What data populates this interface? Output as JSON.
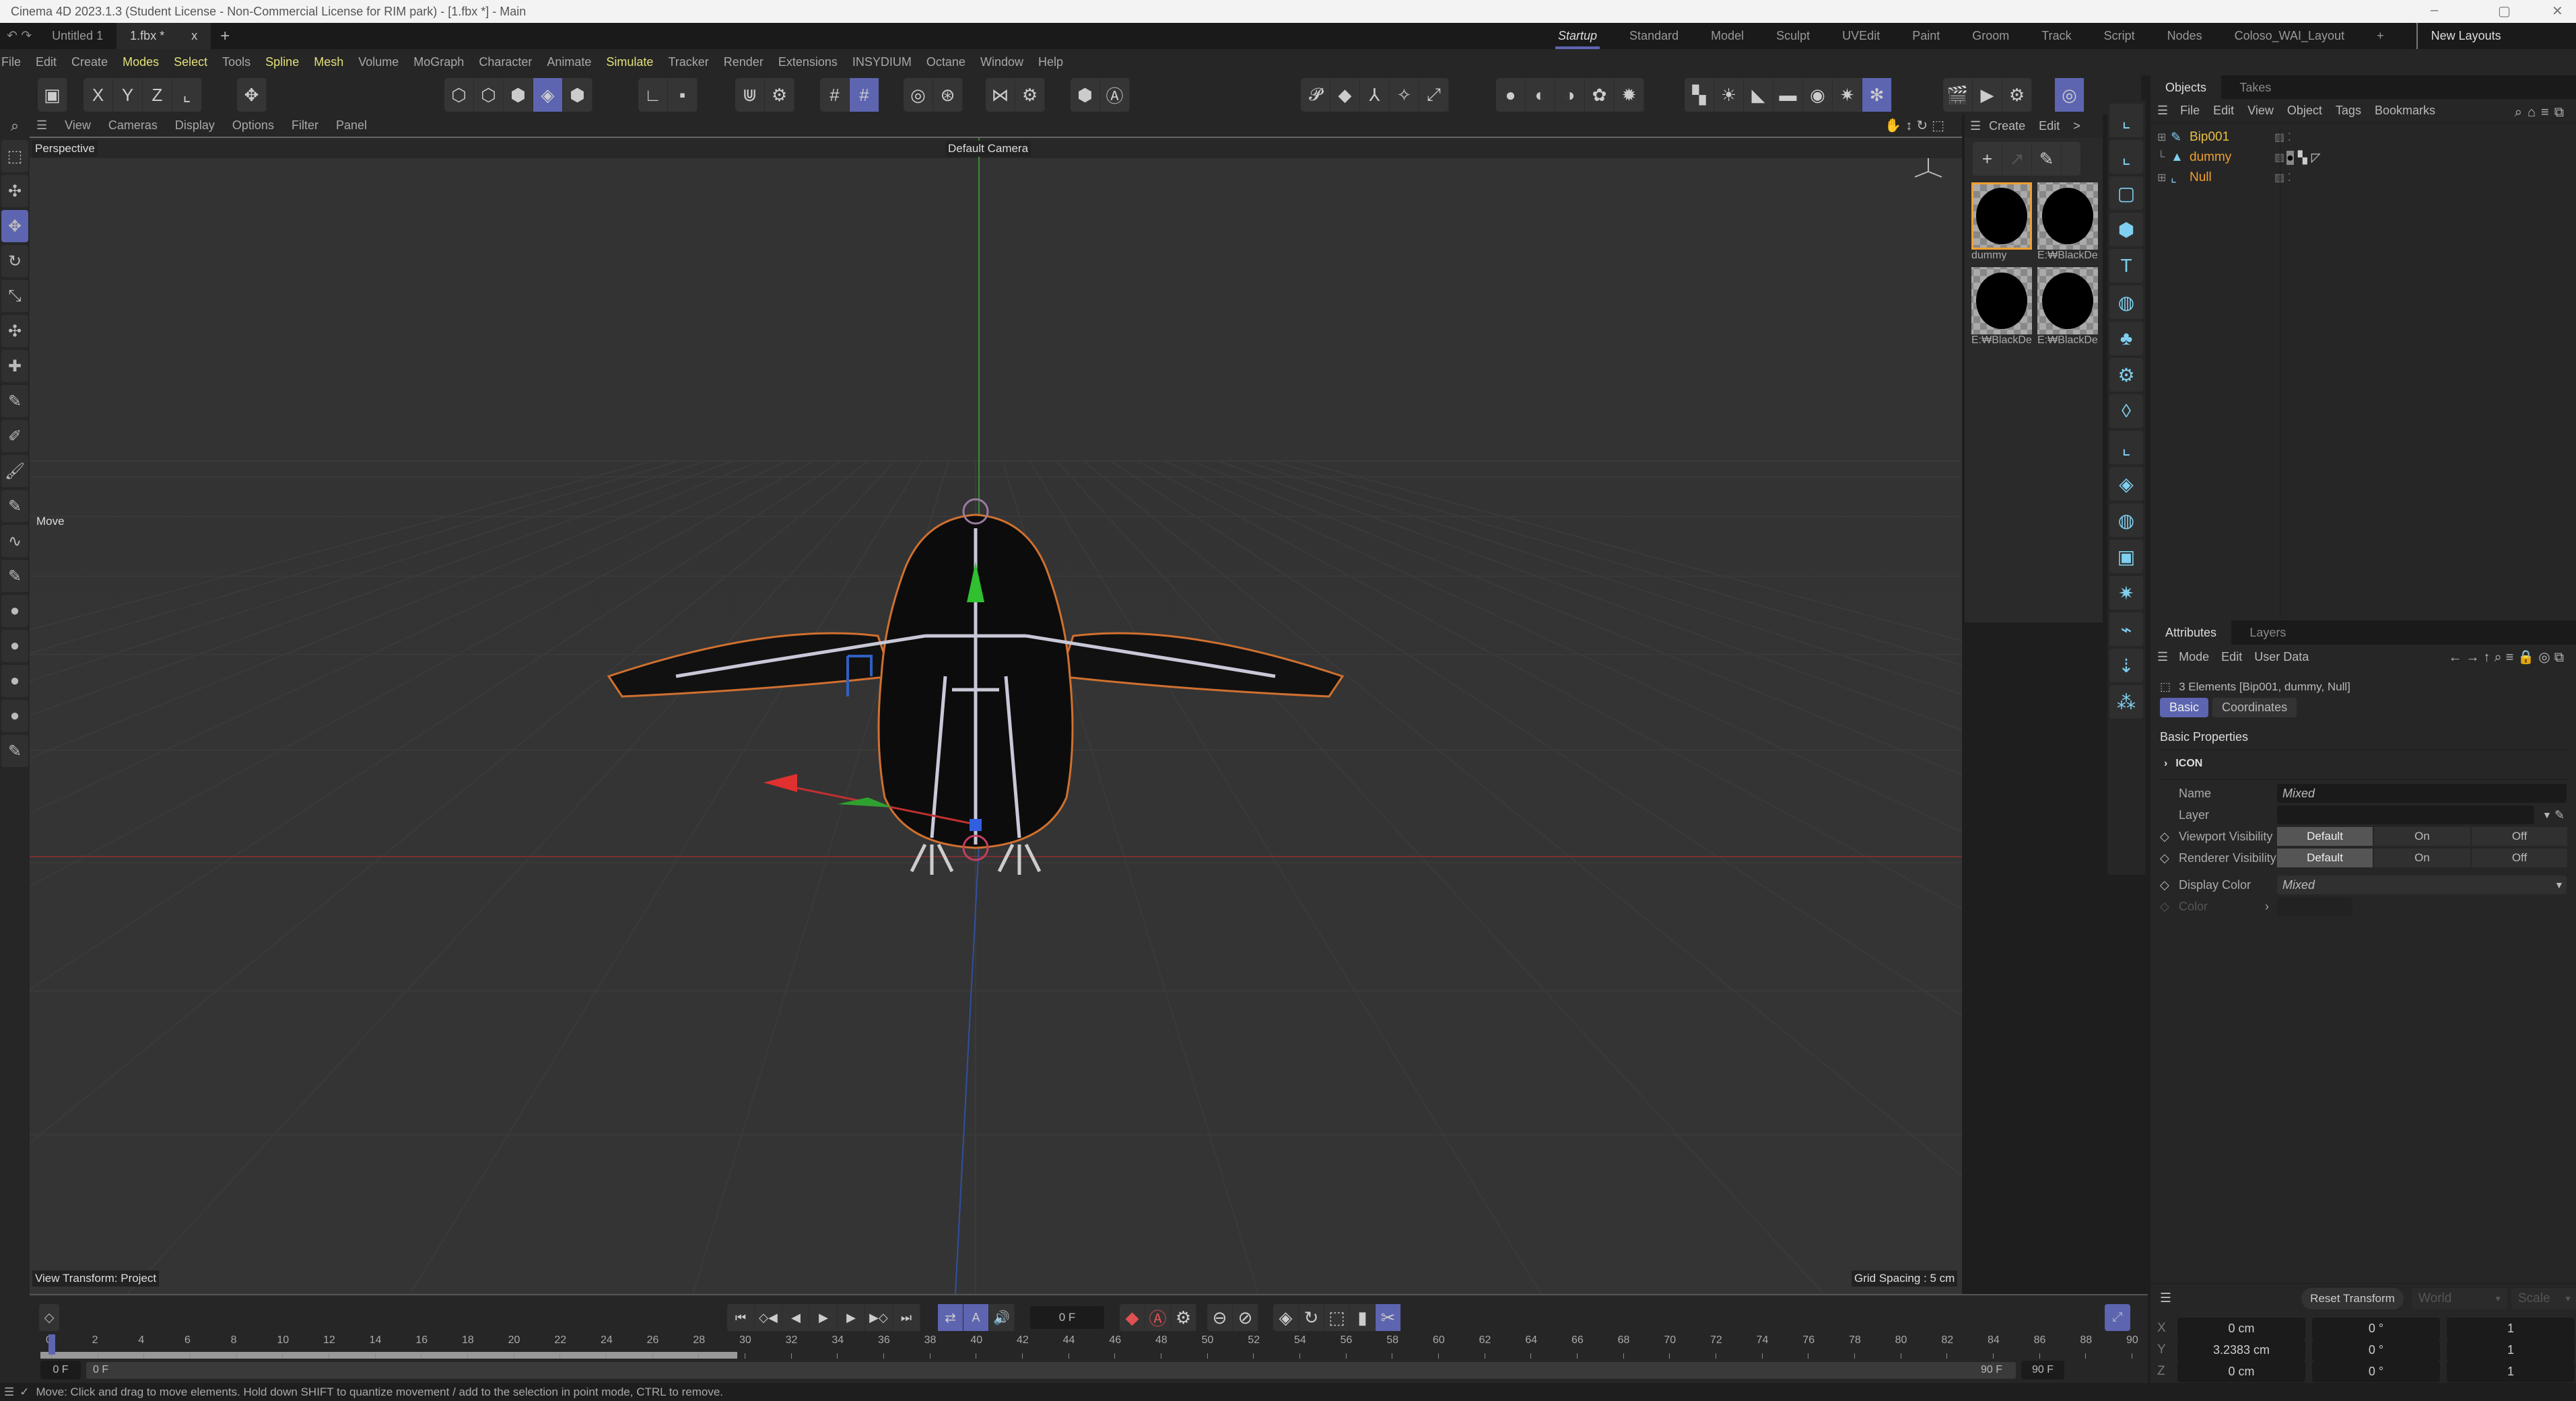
{
  "window": {
    "title": "Cinema 4D 2023.1.3 (Student License - Non-Commercial License for RIM park) - [1.fbx *] - Main",
    "controls": [
      "–",
      "▢",
      "✕"
    ]
  },
  "tabs": {
    "docs": [
      {
        "label": "Untitled 1",
        "active": false
      },
      {
        "label": "1.fbx *",
        "active": true
      }
    ],
    "close": "x",
    "add": "+"
  },
  "layouts": {
    "items": [
      {
        "label": "Startup",
        "active": true
      },
      {
        "label": "Standard"
      },
      {
        "label": "Model"
      },
      {
        "label": "Sculpt"
      },
      {
        "label": "UVEdit"
      },
      {
        "label": "Paint"
      },
      {
        "label": "Groom"
      },
      {
        "label": "Track"
      },
      {
        "label": "Script"
      },
      {
        "label": "Nodes"
      },
      {
        "label": "Coloso_WAI_Layout"
      }
    ],
    "add": "+",
    "new_layouts": "New Layouts"
  },
  "menubar": [
    {
      "label": "File"
    },
    {
      "label": "Edit"
    },
    {
      "label": "Create"
    },
    {
      "label": "Modes",
      "hl": true
    },
    {
      "label": "Select",
      "hl": true
    },
    {
      "label": "Tools"
    },
    {
      "label": "Spline",
      "hl": true
    },
    {
      "label": "Mesh",
      "hl": true
    },
    {
      "label": "Volume"
    },
    {
      "label": "MoGraph"
    },
    {
      "label": "Character"
    },
    {
      "label": "Animate"
    },
    {
      "label": "Simulate",
      "hl": true
    },
    {
      "label": "Tracker"
    },
    {
      "label": "Render"
    },
    {
      "label": "Extensions"
    },
    {
      "label": "INSYDIUM"
    },
    {
      "label": "Octane"
    },
    {
      "label": "Window"
    },
    {
      "label": "Help"
    }
  ],
  "toolbar": {
    "groups": [
      [
        {
          "icon": "undo-history-icon",
          "g": "▣"
        }
      ],
      [
        {
          "icon": "x-axis-lock-icon",
          "g": "X"
        },
        {
          "icon": "y-axis-lock-icon",
          "g": "Y"
        },
        {
          "icon": "z-axis-lock-icon",
          "g": "Z"
        },
        {
          "icon": "coordinate-system-icon",
          "g": "⌞"
        }
      ],
      [
        {
          "icon": "transform-icon",
          "g": "✥"
        }
      ],
      [
        {
          "icon": "points-mode-icon",
          "g": "⬡"
        },
        {
          "icon": "edges-mode-icon",
          "g": "⬡"
        },
        {
          "icon": "polygons-mode-icon",
          "g": "⬢"
        },
        {
          "icon": "model-mode-icon",
          "g": "◈",
          "on": true
        },
        {
          "icon": "texture-mode-icon",
          "g": "⬢"
        }
      ],
      [
        {
          "icon": "axis-mode-icon",
          "g": "∟"
        },
        {
          "icon": "workplane-icon",
          "g": "▪"
        }
      ],
      [
        {
          "icon": "snap-icon",
          "g": "⋓"
        },
        {
          "icon": "snap-settings-icon",
          "g": "⚙"
        }
      ],
      [
        {
          "icon": "grid-icon",
          "g": "#"
        },
        {
          "icon": "grid-lock-icon",
          "g": "#",
          "on": true
        }
      ],
      [
        {
          "icon": "soft-selection-icon",
          "g": "◎"
        },
        {
          "icon": "tweak-icon",
          "g": "⊛"
        }
      ],
      [
        {
          "icon": "symmetry-icon",
          "g": "⋈"
        },
        {
          "icon": "symmetry-settings-icon",
          "g": "⚙"
        }
      ],
      [
        {
          "icon": "viewport-solo-icon",
          "g": "⬢"
        },
        {
          "icon": "auto-icon",
          "g": "Ⓐ"
        }
      ],
      [
        {
          "icon": "python-icon",
          "g": "𝓟"
        },
        {
          "icon": "cube-object-icon",
          "g": "◆"
        },
        {
          "icon": "spline-pen-icon",
          "g": "⅄"
        },
        {
          "icon": "generator-icon",
          "g": "✧"
        },
        {
          "icon": "deformer-icon",
          "g": "⤢"
        }
      ],
      [
        {
          "icon": "render-view-icon",
          "g": "●"
        },
        {
          "icon": "octane-live-icon",
          "g": "◐"
        },
        {
          "icon": "octane-material-icon",
          "g": "◑"
        },
        {
          "icon": "scatter-icon",
          "g": "✿"
        },
        {
          "icon": "fire-icon",
          "g": "✹"
        }
      ],
      [
        {
          "icon": "checker-icon",
          "g": "▚"
        },
        {
          "icon": "sun-light-icon",
          "g": "☀"
        },
        {
          "icon": "spot-light-icon",
          "g": "◣"
        },
        {
          "icon": "area-light-icon",
          "g": "▬"
        },
        {
          "icon": "target-icon",
          "g": "◉"
        },
        {
          "icon": "gear-light-icon",
          "g": "✷"
        },
        {
          "icon": "redshift-icon",
          "g": "✻",
          "on": true
        }
      ],
      [
        {
          "icon": "render-region-icon",
          "g": "🎬"
        },
        {
          "icon": "render-to-viewer-icon",
          "g": "▶"
        },
        {
          "icon": "render-settings-icon",
          "g": "⚙"
        }
      ],
      [
        {
          "icon": "camera-orbit-icon",
          "g": "◎",
          "on": true
        }
      ]
    ]
  },
  "viewport": {
    "menu": [
      "View",
      "Cameras",
      "Display",
      "Options",
      "Filter",
      "Panel"
    ],
    "view_name": "Perspective",
    "camera": "Default Camera",
    "camera_icon": "camera-link-icon",
    "tool_label": "Move",
    "view_transform": "View Transform: Project",
    "grid_spacing": "Grid Spacing : 5 cm",
    "nav_icons": [
      "pan-icon",
      "dolly-icon",
      "rotate-icon",
      "maximize-icon"
    ]
  },
  "left_tools": [
    {
      "icon": "live-selection-icon",
      "g": "⬚"
    },
    {
      "icon": "select-tool-icon",
      "g": "✣"
    },
    {
      "icon": "move-icon",
      "g": "✥",
      "on": true
    },
    {
      "icon": "rotate-icon",
      "g": "↻"
    },
    {
      "icon": "scale-icon",
      "g": "⤡"
    },
    {
      "icon": "move-axis-icon",
      "g": "✣"
    },
    {
      "icon": "scale-axis-icon",
      "g": "✚"
    },
    {
      "icon": "knife-icon",
      "g": "✎"
    },
    {
      "icon": "paint-icon",
      "g": "✐"
    },
    {
      "icon": "brush-icon",
      "g": "🖌"
    },
    {
      "icon": "sculpt-icon",
      "g": "✎"
    },
    {
      "icon": "spline-icon",
      "g": "∿"
    },
    {
      "icon": "magnet-icon",
      "g": "✎"
    },
    {
      "icon": "sphere-icon",
      "g": "●"
    },
    {
      "icon": "sphere-icon",
      "g": "●"
    },
    {
      "icon": "sphere-icon",
      "g": "●"
    },
    {
      "icon": "sphere-icon",
      "g": "●"
    },
    {
      "icon": "pen-icon",
      "g": "✎"
    }
  ],
  "materials": {
    "menu": [
      "Create",
      "Edit"
    ],
    "more": ">",
    "tools": [
      "add-icon",
      "arrow-icon",
      "eyedropper-icon"
    ],
    "items": [
      {
        "name": "dummy",
        "selected": true
      },
      {
        "name": "E:₩BlackDe"
      },
      {
        "name": "E:₩BlackDe"
      },
      {
        "name": "E:₩BlackDe"
      }
    ]
  },
  "object_icons": [
    {
      "icon": "null-object-icon",
      "g": "⌞"
    },
    {
      "icon": "null-point-icon",
      "g": "⌞"
    },
    {
      "icon": "plane-icon",
      "g": "▢"
    },
    {
      "icon": "cube-icon",
      "g": "⬢"
    },
    {
      "icon": "text-icon",
      "g": "T"
    },
    {
      "icon": "cloner-icon",
      "g": "◍"
    },
    {
      "icon": "mograph-icon",
      "g": "♣"
    },
    {
      "icon": "gear-icon",
      "g": "⚙"
    },
    {
      "icon": "deformer-icon",
      "g": "◊"
    },
    {
      "icon": "field-icon",
      "g": "⌞"
    },
    {
      "icon": "volume-icon",
      "g": "◈"
    },
    {
      "icon": "scene-icon",
      "g": "◍"
    },
    {
      "icon": "camera-icon",
      "g": "▣"
    },
    {
      "icon": "light-icon",
      "g": "✷"
    },
    {
      "icon": "tag-icon",
      "g": "⌁"
    },
    {
      "icon": "xpresso-icon",
      "g": "⇣"
    },
    {
      "icon": "particles-icon",
      "g": "⁂"
    }
  ],
  "objects": {
    "tabs": [
      "Objects",
      "Takes"
    ],
    "menu": [
      "File",
      "Edit",
      "View",
      "Object",
      "Tags",
      "Bookmarks"
    ],
    "items": [
      {
        "name": "Bip001",
        "icon": "bone-icon",
        "color": "#e8c040",
        "expandable": true
      },
      {
        "name": "dummy",
        "icon": "polygon-object-icon",
        "color": "#f0a030",
        "tags": [
          "material-tag-icon",
          "uvw-tag-icon",
          "phong-tag-icon"
        ]
      },
      {
        "name": "Null",
        "icon": "null-icon",
        "color": "#f0a030",
        "expandable": true
      }
    ]
  },
  "attributes": {
    "tabs": [
      "Attributes",
      "Layers"
    ],
    "menu": [
      "Mode",
      "Edit",
      "User Data"
    ],
    "selection": "3 Elements [Bip001, dummy, Null]",
    "subtabs": [
      {
        "label": "Basic",
        "active": true
      },
      {
        "label": "Coordinates"
      }
    ],
    "section": "Basic Properties",
    "group": "ICON",
    "name_label": "Name",
    "name_value": "Mixed",
    "layer_label": "Layer",
    "viewport_visibility": {
      "label": "Viewport Visibility",
      "options": [
        "Default",
        "On",
        "Off"
      ]
    },
    "renderer_visibility": {
      "label": "Renderer Visibility",
      "options": [
        "Default",
        "On",
        "Off"
      ]
    },
    "display_color": {
      "label": "Display Color",
      "value": "Mixed"
    },
    "color_label": "Color"
  },
  "coordinates": {
    "reset": "Reset Transform",
    "space": "World",
    "mode": "Scale",
    "rows": [
      {
        "axis": "X",
        "pos": "0 cm",
        "rot": "0 °",
        "scale": "1"
      },
      {
        "axis": "Y",
        "pos": "3.2383 cm",
        "rot": "0 °",
        "scale": "1"
      },
      {
        "axis": "Z",
        "pos": "0 cm",
        "rot": "0 °",
        "scale": "1"
      }
    ]
  },
  "timeline": {
    "current_frame": "0 F",
    "start": "0 F",
    "range_start": "0 F",
    "range_end": "90 F",
    "end": "90 F",
    "ticks": [
      0,
      2,
      4,
      6,
      8,
      10,
      12,
      14,
      16,
      18,
      20,
      22,
      24,
      26,
      28,
      30,
      32,
      34,
      36,
      38,
      40,
      42,
      44,
      46,
      48,
      50,
      52,
      54,
      56,
      58,
      60,
      62,
      64,
      66,
      68,
      70,
      72,
      74,
      76,
      78,
      80,
      82,
      84,
      86,
      88,
      90
    ],
    "playhead": 0,
    "transport": [
      "go-start-icon",
      "prev-key-icon",
      "prev-frame-icon",
      "play-icon",
      "next-frame-icon",
      "next-key-icon",
      "go-end-icon"
    ],
    "transport_g": [
      "⏮",
      "◇◀",
      "◀",
      "▶",
      "▶",
      "▶◇",
      "⏭"
    ]
  },
  "status": {
    "text": "Move: Click and drag to move elements. Hold down SHIFT to quantize movement / add to the selection in point mode, CTRL to remove."
  },
  "colors": {
    "accent": "#5d64b0",
    "highlight_menu": "#e3e07a",
    "object_name": "#f0a030",
    "record": "#e05050"
  }
}
